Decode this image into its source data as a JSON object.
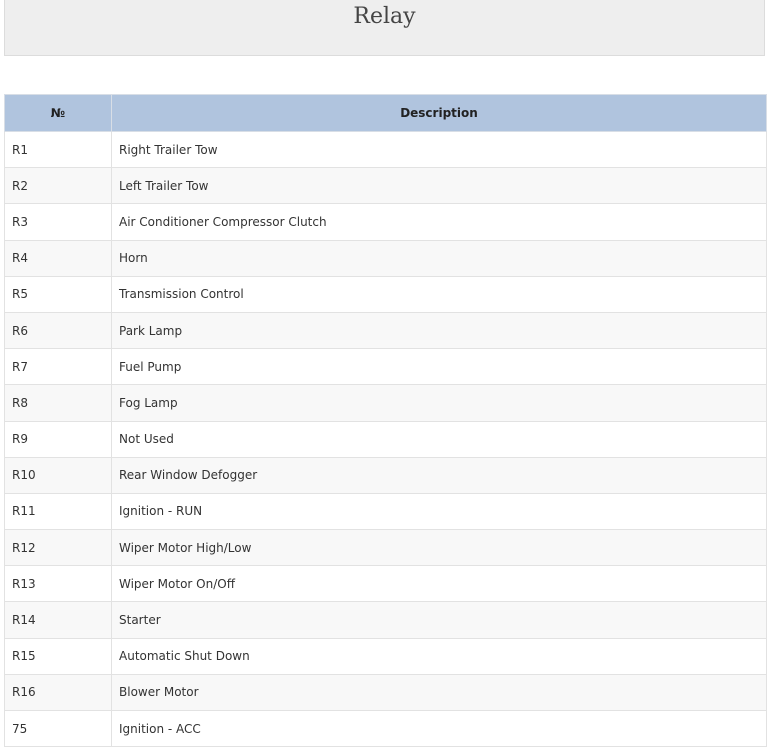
{
  "page": {
    "title": "Relay"
  },
  "table": {
    "headers": [
      "№",
      "Description"
    ],
    "rows": [
      {
        "num": "R1",
        "desc": "Right Trailer Tow"
      },
      {
        "num": "R2",
        "desc": "Left Trailer Tow"
      },
      {
        "num": "R3",
        "desc": "Air Conditioner Compressor Clutch"
      },
      {
        "num": "R4",
        "desc": "Horn"
      },
      {
        "num": "R5",
        "desc": "Transmission Control"
      },
      {
        "num": "R6",
        "desc": "Park Lamp"
      },
      {
        "num": "R7",
        "desc": "Fuel Pump"
      },
      {
        "num": "R8",
        "desc": "Fog Lamp"
      },
      {
        "num": "R9",
        "desc": "Not Used"
      },
      {
        "num": "R10",
        "desc": "Rear Window Defogger"
      },
      {
        "num": "R11",
        "desc": "Ignition - RUN"
      },
      {
        "num": "R12",
        "desc": "Wiper Motor High/Low"
      },
      {
        "num": "R13",
        "desc": "Wiper Motor On/Off"
      },
      {
        "num": "R14",
        "desc": "Starter"
      },
      {
        "num": "R15",
        "desc": "Automatic Shut Down"
      },
      {
        "num": "R16",
        "desc": "Blower Motor"
      },
      {
        "num": "75",
        "desc": "Ignition - ACC"
      }
    ]
  },
  "colors": {
    "header_bg": "#b0c4de",
    "title_bg": "#eeeeee",
    "row_alt_bg": "#f8f8f8"
  }
}
